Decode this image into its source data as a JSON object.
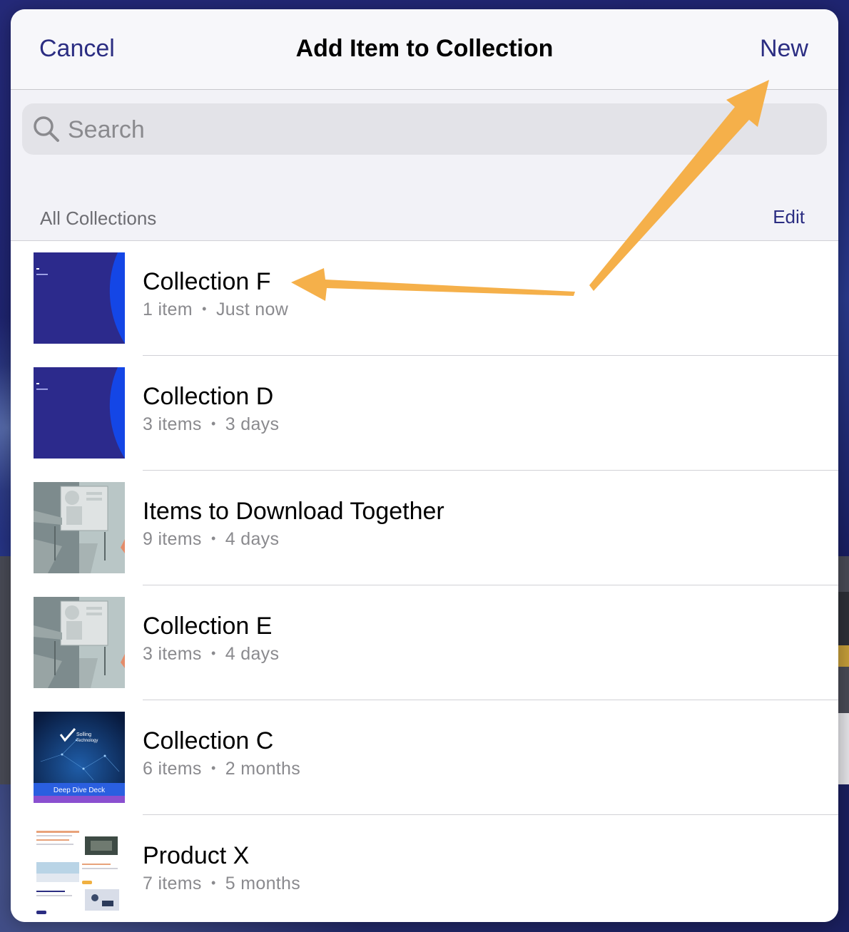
{
  "navbar": {
    "cancel_label": "Cancel",
    "title": "Add Item to Collection",
    "new_label": "New"
  },
  "search": {
    "placeholder": "Search",
    "icon": "search-icon"
  },
  "section": {
    "label": "All Collections",
    "edit_label": "Edit"
  },
  "collections": [
    {
      "name": "Collection F",
      "count": "1 item",
      "age": "Just now",
      "thumb": "dark-blue-slide"
    },
    {
      "name": "Collection D",
      "count": "3 items",
      "age": "3 days",
      "thumb": "dark-blue-slide"
    },
    {
      "name": "Items to Download Together",
      "count": "9 items",
      "age": "4 days",
      "thumb": "grey-illustration"
    },
    {
      "name": "Collection E",
      "count": "3 items",
      "age": "4 days",
      "thumb": "grey-illustration"
    },
    {
      "name": "Collection C",
      "count": "6 items",
      "age": "2 months",
      "thumb": "deep-dive-deck",
      "thumb_text": {
        "brand_line1": "Solling",
        "brand_line2": "Technology",
        "banner": "Deep Dive Deck"
      }
    },
    {
      "name": "Product X",
      "count": "7 items",
      "age": "5 months",
      "thumb": "web-page"
    }
  ],
  "meta_separator": "•",
  "colors": {
    "accent": "#2b2d82",
    "annotation_arrow": "#f5b04a",
    "sheet_bg": "#f2f2f7"
  }
}
